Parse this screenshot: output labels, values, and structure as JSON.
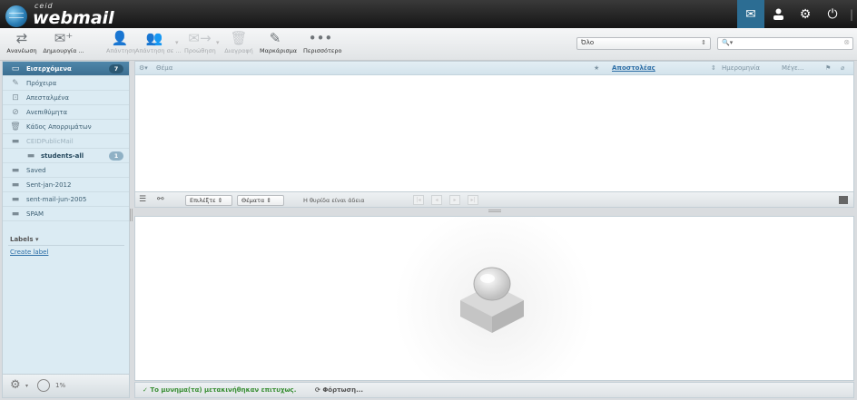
{
  "header": {
    "logo_small": "ceid",
    "logo_main": "webmail",
    "icons": [
      "mail-icon",
      "user-icon",
      "gear-icon",
      "power-icon"
    ]
  },
  "toolbar": {
    "refresh": "Ανανέωση",
    "compose": "Δημιουργία ...",
    "reply": "Απάντηση",
    "reply_all": "Απάντηση σε ...",
    "forward": "Προώθηση",
    "delete": "Διαγραφή",
    "mark": "Μαρκάρισμα",
    "more": "Περισσότερο"
  },
  "filter": {
    "value": "Όλο",
    "search_placeholder": ""
  },
  "folders": [
    {
      "label": "Εισερχόμενα",
      "count": "7",
      "selected": true
    },
    {
      "label": "Πρόχειρα"
    },
    {
      "label": "Απεσταλμένα"
    },
    {
      "label": "Ανεπιθύμητα"
    },
    {
      "label": "Κάδος Απορριμάτων"
    },
    {
      "label": "CEIDPublicMail",
      "dim": true
    },
    {
      "label": "students-all",
      "count": "1",
      "sub": true
    },
    {
      "label": "Saved"
    },
    {
      "label": "Sent-jan-2012"
    },
    {
      "label": "sent-mail-jun-2005"
    },
    {
      "label": "SPAM"
    }
  ],
  "labels": {
    "title": "Labels",
    "create": "Create label"
  },
  "sidebar_footer": {
    "quota": "1%"
  },
  "list": {
    "columns": {
      "subject": "Θέμα",
      "sender": "Αποστολέας",
      "date": "Ημερομηνία",
      "size": "Μέγε..."
    }
  },
  "list_footer": {
    "select": "Επιλέξτε",
    "threads": "Θέματα",
    "empty": "Η θυρίδα είναι άδεια"
  },
  "status": {
    "message": "Το μυνημα(τα) μετακινήθηκαν επιτυχως.",
    "loading": "Φόρτωση..."
  }
}
